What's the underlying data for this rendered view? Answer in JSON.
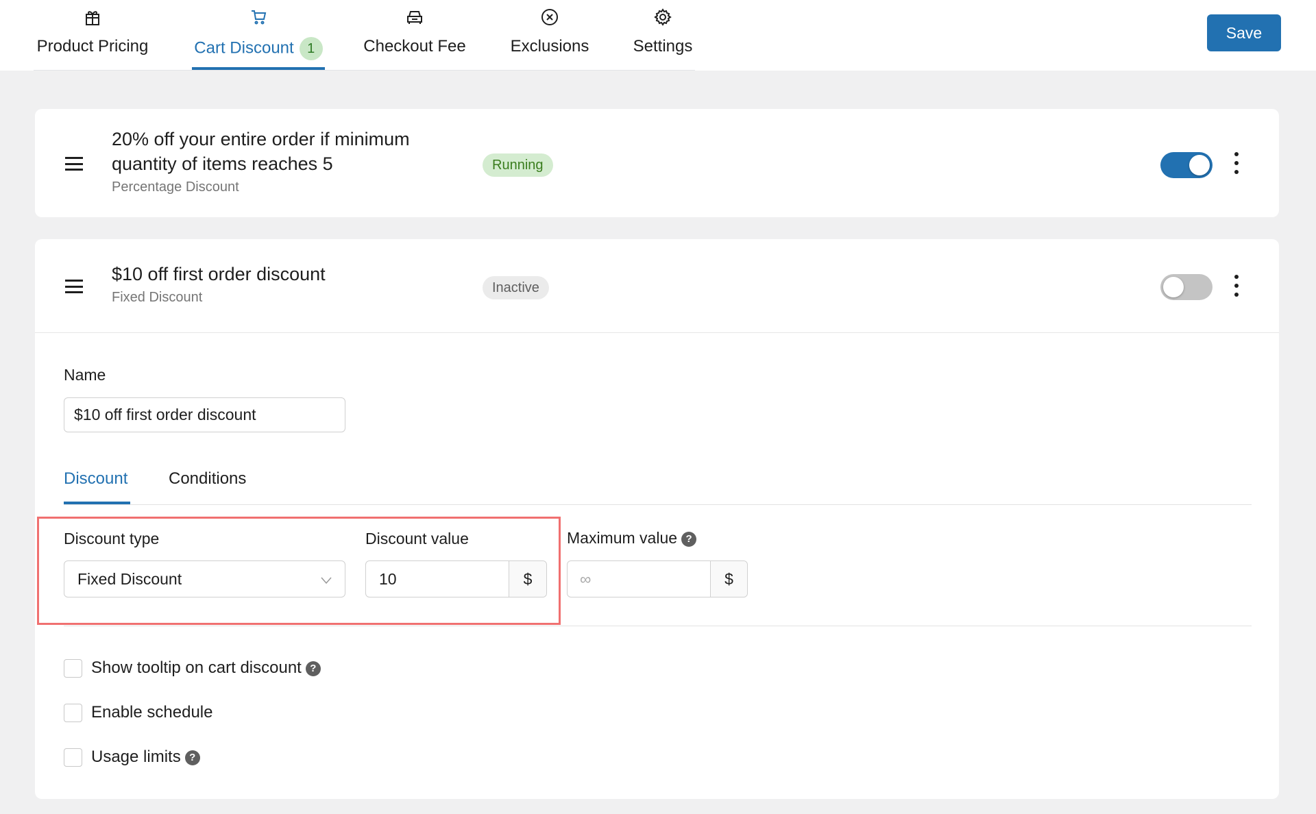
{
  "tabs": [
    {
      "label": "Product Pricing",
      "icon": "gift-icon"
    },
    {
      "label": "Cart Discount",
      "icon": "cart-icon",
      "count": "1",
      "active": true
    },
    {
      "label": "Checkout Fee",
      "icon": "car-icon"
    },
    {
      "label": "Exclusions",
      "icon": "x-circle-icon"
    },
    {
      "label": "Settings",
      "icon": "gear-icon"
    }
  ],
  "save_label": "Save",
  "rules": [
    {
      "title_line1": "20% off your entire order if minimum",
      "title_line2": "quantity of items reaches 5",
      "type": "Percentage Discount",
      "status": "Running",
      "enabled": true
    },
    {
      "title": "$10 off first order discount",
      "type": "Fixed Discount",
      "status": "Inactive",
      "enabled": false
    }
  ],
  "editor": {
    "name_label": "Name",
    "name_value": "$10 off first order discount",
    "subtabs": [
      "Discount",
      "Conditions"
    ],
    "discount_type_label": "Discount type",
    "discount_type_value": "Fixed Discount",
    "discount_value_label": "Discount value",
    "discount_value": "10",
    "currency": "$",
    "max_value_label": "Maximum value",
    "max_value_placeholder": "∞",
    "help": "?",
    "checkboxes": [
      "Show tooltip on cart discount",
      "Enable schedule",
      "Usage limits"
    ]
  },
  "colors": {
    "accent": "#2271b1",
    "running_bg": "#d4ecd0",
    "running_text": "#3a7d1e",
    "highlight": "#f07070"
  }
}
